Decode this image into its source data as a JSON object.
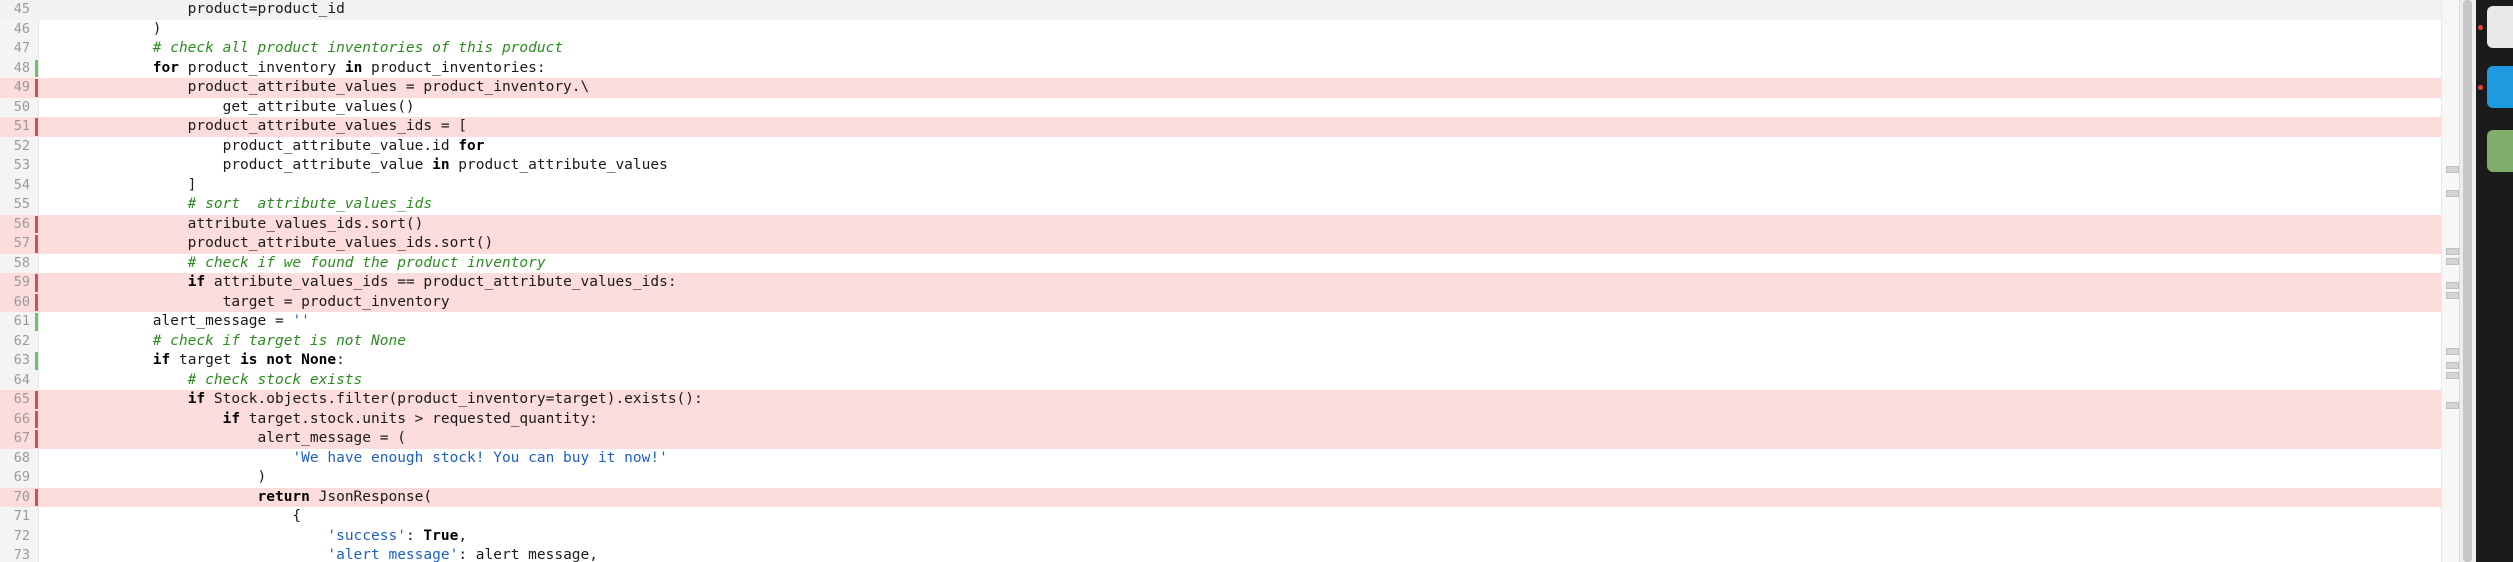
{
  "editor": {
    "lines": [
      {
        "n": "45",
        "marker": "",
        "hl": false,
        "first": true,
        "tokens": [
          {
            "t": "",
            "s": "                product=product_id"
          }
        ]
      },
      {
        "n": "46",
        "marker": "",
        "hl": false,
        "tokens": [
          {
            "t": "",
            "s": "            )"
          }
        ]
      },
      {
        "n": "47",
        "marker": "",
        "hl": false,
        "tokens": [
          {
            "t": "cm",
            "s": "            # check all product inventories of this product"
          }
        ]
      },
      {
        "n": "48",
        "marker": "add",
        "hl": false,
        "tokens": [
          {
            "t": "",
            "s": "            "
          },
          {
            "t": "kw",
            "s": "for"
          },
          {
            "t": "",
            "s": " product_inventory "
          },
          {
            "t": "kw",
            "s": "in"
          },
          {
            "t": "",
            "s": " product_inventories:"
          }
        ]
      },
      {
        "n": "49",
        "marker": "mod",
        "hl": true,
        "tokens": [
          {
            "t": "",
            "s": "                product_attribute_values = product_inventory.\\"
          }
        ]
      },
      {
        "n": "50",
        "marker": "",
        "hl": false,
        "tokens": [
          {
            "t": "",
            "s": "                    get_attribute_values()"
          }
        ]
      },
      {
        "n": "51",
        "marker": "mod",
        "hl": true,
        "tokens": [
          {
            "t": "",
            "s": "                product_attribute_values_ids = ["
          }
        ]
      },
      {
        "n": "52",
        "marker": "",
        "hl": false,
        "tokens": [
          {
            "t": "",
            "s": "                    product_attribute_value.id "
          },
          {
            "t": "kw",
            "s": "for"
          }
        ]
      },
      {
        "n": "53",
        "marker": "",
        "hl": false,
        "tokens": [
          {
            "t": "",
            "s": "                    product_attribute_value "
          },
          {
            "t": "kw",
            "s": "in"
          },
          {
            "t": "",
            "s": " product_attribute_values"
          }
        ]
      },
      {
        "n": "54",
        "marker": "",
        "hl": false,
        "tokens": [
          {
            "t": "",
            "s": "                ]"
          }
        ]
      },
      {
        "n": "55",
        "marker": "",
        "hl": false,
        "tokens": [
          {
            "t": "cm",
            "s": "                # sort  attribute_values_ids"
          }
        ]
      },
      {
        "n": "56",
        "marker": "mod",
        "hl": true,
        "tokens": [
          {
            "t": "",
            "s": "                attribute_values_ids.sort()"
          }
        ]
      },
      {
        "n": "57",
        "marker": "mod",
        "hl": true,
        "tokens": [
          {
            "t": "",
            "s": "                product_attribute_values_ids.sort()"
          }
        ]
      },
      {
        "n": "58",
        "marker": "",
        "hl": false,
        "tokens": [
          {
            "t": "cm",
            "s": "                # check if we found the product inventory"
          }
        ]
      },
      {
        "n": "59",
        "marker": "mod",
        "hl": true,
        "tokens": [
          {
            "t": "",
            "s": "                "
          },
          {
            "t": "kw",
            "s": "if"
          },
          {
            "t": "",
            "s": " attribute_values_ids == product_attribute_values_ids:"
          }
        ]
      },
      {
        "n": "60",
        "marker": "mod",
        "hl": true,
        "tokens": [
          {
            "t": "",
            "s": "                    target = product_inventory"
          }
        ]
      },
      {
        "n": "61",
        "marker": "add",
        "hl": false,
        "tokens": [
          {
            "t": "",
            "s": "            alert_message = "
          },
          {
            "t": "st",
            "s": "''"
          }
        ]
      },
      {
        "n": "62",
        "marker": "",
        "hl": false,
        "tokens": [
          {
            "t": "cm",
            "s": "            # check if target is not None"
          }
        ]
      },
      {
        "n": "63",
        "marker": "add",
        "hl": false,
        "tokens": [
          {
            "t": "",
            "s": "            "
          },
          {
            "t": "kw",
            "s": "if"
          },
          {
            "t": "",
            "s": " target "
          },
          {
            "t": "kw",
            "s": "is not None"
          },
          {
            "t": "",
            "s": ":"
          }
        ]
      },
      {
        "n": "64",
        "marker": "",
        "hl": false,
        "tokens": [
          {
            "t": "cm",
            "s": "                # check stock exists"
          }
        ]
      },
      {
        "n": "65",
        "marker": "mod",
        "hl": true,
        "tokens": [
          {
            "t": "",
            "s": "                "
          },
          {
            "t": "kw",
            "s": "if"
          },
          {
            "t": "",
            "s": " Stock.objects.filter(product_inventory=target).exists():"
          }
        ]
      },
      {
        "n": "66",
        "marker": "mod",
        "hl": true,
        "tokens": [
          {
            "t": "",
            "s": "                    "
          },
          {
            "t": "kw",
            "s": "if"
          },
          {
            "t": "",
            "s": " target.stock.units > requested_quantity:"
          }
        ]
      },
      {
        "n": "67",
        "marker": "mod",
        "hl": true,
        "tokens": [
          {
            "t": "",
            "s": "                        alert_message = ("
          }
        ]
      },
      {
        "n": "68",
        "marker": "",
        "hl": false,
        "tokens": [
          {
            "t": "",
            "s": "                            "
          },
          {
            "t": "st",
            "s": "'We have enough stock! You can buy it now!'"
          }
        ]
      },
      {
        "n": "69",
        "marker": "",
        "hl": false,
        "tokens": [
          {
            "t": "",
            "s": "                        )"
          }
        ]
      },
      {
        "n": "70",
        "marker": "mod",
        "hl": true,
        "tokens": [
          {
            "t": "",
            "s": "                        "
          },
          {
            "t": "kw",
            "s": "return"
          },
          {
            "t": "",
            "s": " JsonResponse("
          }
        ]
      },
      {
        "n": "71",
        "marker": "",
        "hl": false,
        "tokens": [
          {
            "t": "",
            "s": "                            {"
          }
        ]
      },
      {
        "n": "72",
        "marker": "",
        "hl": false,
        "tokens": [
          {
            "t": "",
            "s": "                                "
          },
          {
            "t": "st",
            "s": "'success'"
          },
          {
            "t": "",
            "s": ": "
          },
          {
            "t": "kw",
            "s": "True"
          },
          {
            "t": "",
            "s": ","
          }
        ]
      },
      {
        "n": "73",
        "marker": "",
        "hl": false,
        "tokens": [
          {
            "t": "",
            "s": "                                "
          },
          {
            "t": "st",
            "s": "'alert_message'"
          },
          {
            "t": "",
            "s": ": alert_message,"
          }
        ]
      }
    ]
  },
  "colors": {
    "changed_line_bg": "#fddcdc",
    "modified_marker": "#d0505a",
    "added_marker": "#6cc26c",
    "keyword": "#000000",
    "comment": "#2e8b22",
    "string": "#1f5fbf"
  },
  "dock": {
    "icons": [
      {
        "name": "app-icon-1",
        "color": "#e9e9e9",
        "indicator": true
      },
      {
        "name": "skype-icon",
        "color": "#1e9be0",
        "indicator": true
      },
      {
        "name": "trash-icon",
        "color": "#7fae6a",
        "indicator": false
      }
    ]
  }
}
